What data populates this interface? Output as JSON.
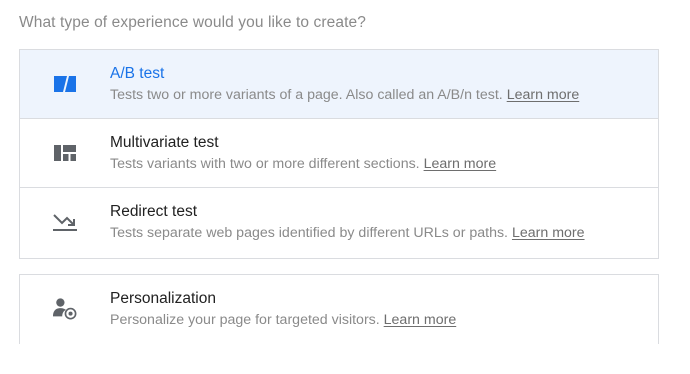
{
  "question": "What type of experience would you like to create?",
  "options": [
    {
      "title": "A/B test",
      "description": "Tests two or more variants of a page. Also called an A/B/n test.",
      "learn_more": "Learn more",
      "icon": "ab-test-icon",
      "selected": true
    },
    {
      "title": "Multivariate test",
      "description": "Tests variants with two or more different sections.",
      "learn_more": "Learn more",
      "icon": "multivariate-grid-icon",
      "selected": false
    },
    {
      "title": "Redirect test",
      "description": "Tests separate web pages identified by different URLs or paths.",
      "learn_more": "Learn more",
      "icon": "redirect-arrow-icon",
      "selected": false
    }
  ],
  "personalization": {
    "title": "Personalization",
    "description": "Personalize your page for targeted visitors.",
    "learn_more": "Learn more",
    "icon": "person-target-icon"
  },
  "colors": {
    "accent": "#1a73e8",
    "selected_bg": "#eef4fd",
    "border": "#dadce0",
    "muted_text": "#8a8a8a"
  }
}
